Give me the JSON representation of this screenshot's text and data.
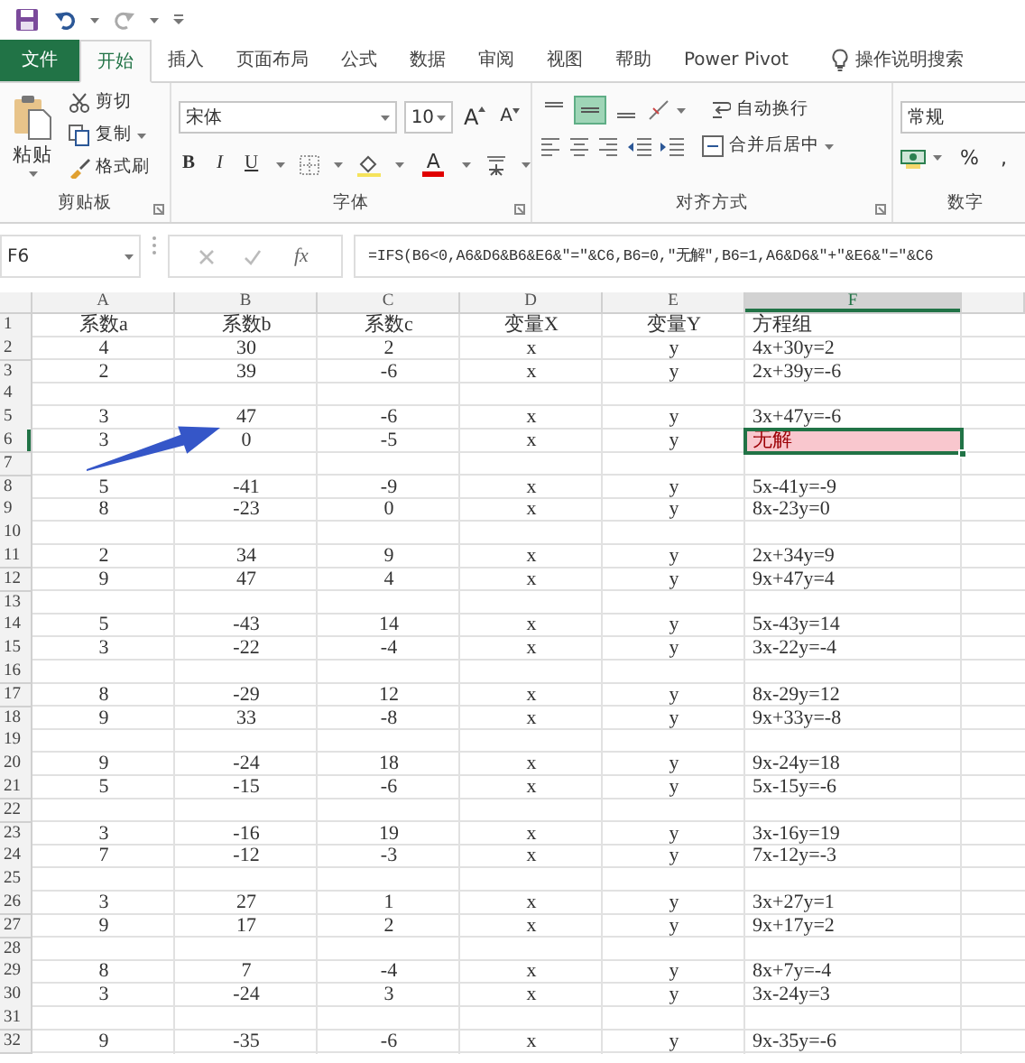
{
  "quick_access": [
    {
      "kind": "save"
    },
    {
      "kind": "undo"
    },
    {
      "kind": "redo"
    },
    {
      "kind": "customize"
    }
  ],
  "tabs": [
    {
      "label": "文件",
      "kind": "file"
    },
    {
      "label": "开始",
      "kind": "tab",
      "selected": true
    },
    {
      "label": "插入",
      "kind": "tab",
      "selected": false
    },
    {
      "label": "页面布局",
      "kind": "tab",
      "selected": false
    },
    {
      "label": "公式",
      "kind": "tab",
      "selected": false
    },
    {
      "label": "数据",
      "kind": "tab",
      "selected": false
    },
    {
      "label": "审阅",
      "kind": "tab",
      "selected": false
    },
    {
      "label": "视图",
      "kind": "tab",
      "selected": false
    },
    {
      "label": "帮助",
      "kind": "tab",
      "selected": false
    },
    {
      "label": "Power Pivot",
      "kind": "tab",
      "selected": false
    },
    {
      "label": "操作说明搜索",
      "kind": "search"
    }
  ],
  "ribbon": {
    "clipboard": {
      "title": "剪贴板",
      "paste": "粘贴",
      "items": [
        {
          "label": "剪切",
          "kind": "cut"
        },
        {
          "label": "复制",
          "kind": "copy"
        },
        {
          "label": "格式刷",
          "kind": "brush"
        }
      ]
    },
    "font": {
      "title": "字体",
      "font_name": "宋体",
      "font_size": "10",
      "size_buttons": [
        {
          "label": "A",
          "kind": "grow"
        },
        {
          "label": "A",
          "kind": "shrink"
        }
      ],
      "style_buttons": [
        {
          "label": "B",
          "kind": "bold"
        },
        {
          "label": "I",
          "kind": "italic"
        },
        {
          "label": "U",
          "kind": "underline"
        }
      ],
      "font_color": {
        "label": "A"
      }
    },
    "alignment": {
      "title": "对齐方式",
      "vertical": [
        {
          "kind": "top",
          "selected": false
        },
        {
          "kind": "middle",
          "selected": true
        },
        {
          "kind": "bottom",
          "selected": false
        }
      ],
      "horizontal": [
        {
          "kind": "left"
        },
        {
          "kind": "center"
        },
        {
          "kind": "right"
        }
      ],
      "wrap": "自动换行",
      "merge": "合并后居中"
    },
    "number": {
      "title": "数字",
      "format": "常规",
      "symbols": [
        "%",
        ","
      ]
    }
  },
  "formula_bar": {
    "name_box": "F6",
    "function_label": "fx",
    "formula": "=IFS(B6<0,A6&D6&B6&E6&\"=\"&C6,B6=0,\"无解\",B6=1,A6&D6&\"+\"&E6&\"=\"&C6"
  },
  "sheet": {
    "columns": [
      {
        "label": "A",
        "selected": false
      },
      {
        "label": "B",
        "selected": false
      },
      {
        "label": "C",
        "selected": false
      },
      {
        "label": "D",
        "selected": false
      },
      {
        "label": "E",
        "selected": false
      },
      {
        "label": "F",
        "selected": true
      }
    ],
    "rows": [
      {
        "number": "1",
        "cells": [
          "系数a",
          "系数b",
          "系数c",
          "变量X",
          "变量Y",
          "方程组"
        ],
        "selected": false,
        "flagged": false
      },
      {
        "number": "2",
        "cells": [
          "4",
          "30",
          "2",
          "x",
          "y",
          "4x+30y=2"
        ],
        "selected": false,
        "flagged": false
      },
      {
        "number": "3",
        "cells": [
          "2",
          "39",
          "-6",
          "x",
          "y",
          "2x+39y=-6"
        ],
        "selected": false,
        "flagged": false
      },
      {
        "number": "4",
        "selected": false,
        "flagged": false
      },
      {
        "number": "5",
        "cells": [
          "3",
          "47",
          "-6",
          "x",
          "y",
          "3x+47y=-6"
        ],
        "selected": false,
        "flagged": false
      },
      {
        "number": "6",
        "cells": [
          "3",
          "0",
          "-5",
          "x",
          "y",
          "无解"
        ],
        "selected": true,
        "flagged": true
      },
      {
        "number": "7",
        "selected": false,
        "flagged": false
      },
      {
        "number": "8",
        "cells": [
          "5",
          "-41",
          "-9",
          "x",
          "y",
          "5x-41y=-9"
        ],
        "selected": false,
        "flagged": false
      },
      {
        "number": "9",
        "cells": [
          "8",
          "-23",
          "0",
          "x",
          "y",
          "8x-23y=0"
        ],
        "selected": false,
        "flagged": false
      },
      {
        "number": "10",
        "selected": false,
        "flagged": false
      },
      {
        "number": "11",
        "cells": [
          "2",
          "34",
          "9",
          "x",
          "y",
          "2x+34y=9"
        ],
        "selected": false,
        "flagged": false
      },
      {
        "number": "12",
        "cells": [
          "9",
          "47",
          "4",
          "x",
          "y",
          "9x+47y=4"
        ],
        "selected": false,
        "flagged": false
      },
      {
        "number": "13",
        "selected": false,
        "flagged": false
      },
      {
        "number": "14",
        "cells": [
          "5",
          "-43",
          "14",
          "x",
          "y",
          "5x-43y=14"
        ],
        "selected": false,
        "flagged": false
      },
      {
        "number": "15",
        "cells": [
          "3",
          "-22",
          "-4",
          "x",
          "y",
          "3x-22y=-4"
        ],
        "selected": false,
        "flagged": false
      },
      {
        "number": "16",
        "selected": false,
        "flagged": false
      },
      {
        "number": "17",
        "cells": [
          "8",
          "-29",
          "12",
          "x",
          "y",
          "8x-29y=12"
        ],
        "selected": false,
        "flagged": false
      },
      {
        "number": "18",
        "cells": [
          "9",
          "33",
          "-8",
          "x",
          "y",
          "9x+33y=-8"
        ],
        "selected": false,
        "flagged": false
      },
      {
        "number": "19",
        "selected": false,
        "flagged": false
      },
      {
        "number": "20",
        "cells": [
          "9",
          "-24",
          "18",
          "x",
          "y",
          "9x-24y=18"
        ],
        "selected": false,
        "flagged": false
      },
      {
        "number": "21",
        "cells": [
          "5",
          "-15",
          "-6",
          "x",
          "y",
          "5x-15y=-6"
        ],
        "selected": false,
        "flagged": false
      },
      {
        "number": "22",
        "selected": false,
        "flagged": false
      },
      {
        "number": "23",
        "cells": [
          "3",
          "-16",
          "19",
          "x",
          "y",
          "3x-16y=19"
        ],
        "selected": false,
        "flagged": false
      },
      {
        "number": "24",
        "cells": [
          "7",
          "-12",
          "-3",
          "x",
          "y",
          "7x-12y=-3"
        ],
        "selected": false,
        "flagged": false
      },
      {
        "number": "25",
        "selected": false,
        "flagged": false
      },
      {
        "number": "26",
        "cells": [
          "3",
          "27",
          "1",
          "x",
          "y",
          "3x+27y=1"
        ],
        "selected": false,
        "flagged": false
      },
      {
        "number": "27",
        "cells": [
          "9",
          "17",
          "2",
          "x",
          "y",
          "9x+17y=2"
        ],
        "selected": false,
        "flagged": false
      },
      {
        "number": "28",
        "selected": false,
        "flagged": false
      },
      {
        "number": "29",
        "cells": [
          "8",
          "7",
          "-4",
          "x",
          "y",
          "8x+7y=-4"
        ],
        "selected": false,
        "flagged": false
      },
      {
        "number": "30",
        "cells": [
          "3",
          "-24",
          "3",
          "x",
          "y",
          "3x-24y=3"
        ],
        "selected": false,
        "flagged": false
      },
      {
        "number": "31",
        "selected": false,
        "flagged": false
      },
      {
        "number": "32",
        "cells": [
          "9",
          "-35",
          "-6",
          "x",
          "y",
          "9x-35y=-6"
        ],
        "selected": false,
        "flagged": false
      }
    ],
    "annotations": [
      {
        "kind": "arrow"
      }
    ]
  }
}
